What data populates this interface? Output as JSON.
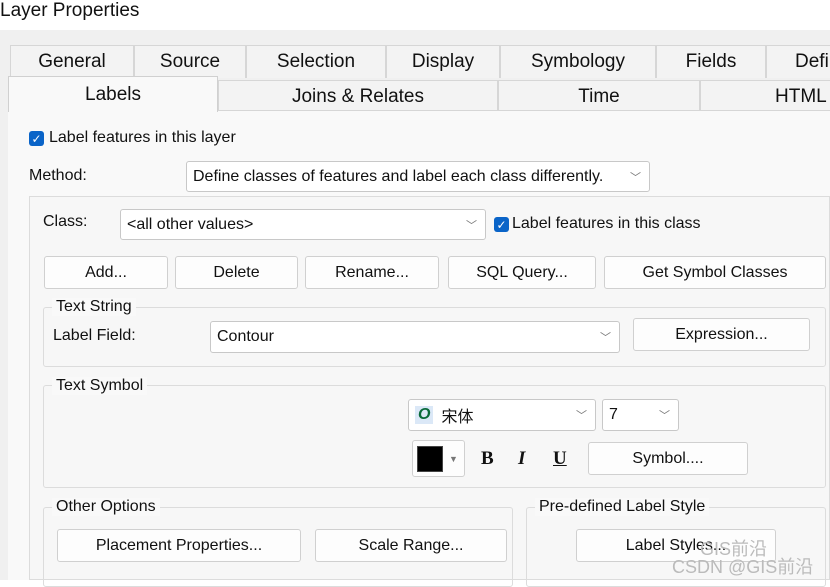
{
  "window": {
    "title": "Layer Properties"
  },
  "tabs_row1": [
    "General",
    "Source",
    "Selection",
    "Display",
    "Symbology",
    "Fields",
    "Defi"
  ],
  "tabs_row2": [
    "Labels",
    "Joins & Relates",
    "Time",
    "HTML"
  ],
  "label_features_layer": "Label features in this layer",
  "method": {
    "label": "Method:",
    "value": "Define classes of features and label each class differently."
  },
  "class": {
    "label": "Class:",
    "value": "<all other values>",
    "label_class": "Label features in this class"
  },
  "buttons": {
    "add": "Add...",
    "delete": "Delete",
    "rename": "Rename...",
    "sql": "SQL Query...",
    "get_symbol_classes": "Get Symbol Classes"
  },
  "text_string": {
    "title": "Text String",
    "field_label": "Label Field:",
    "field_value": "Contour",
    "expression": "Expression..."
  },
  "text_symbol": {
    "title": "Text Symbol",
    "font": "宋体",
    "size": "7",
    "color": "#000000",
    "bold": "B",
    "italic": "I",
    "underline": "U",
    "symbol": "Symbol...."
  },
  "other_options": {
    "title": "Other Options",
    "placement": "Placement Properties...",
    "scale_range": "Scale Range..."
  },
  "predefined": {
    "title": "Pre-defined Label Style",
    "label_styles": "Label Styles..."
  },
  "watermark": {
    "line1": "GIS前沿",
    "line2": "CSDN @GIS前沿"
  }
}
